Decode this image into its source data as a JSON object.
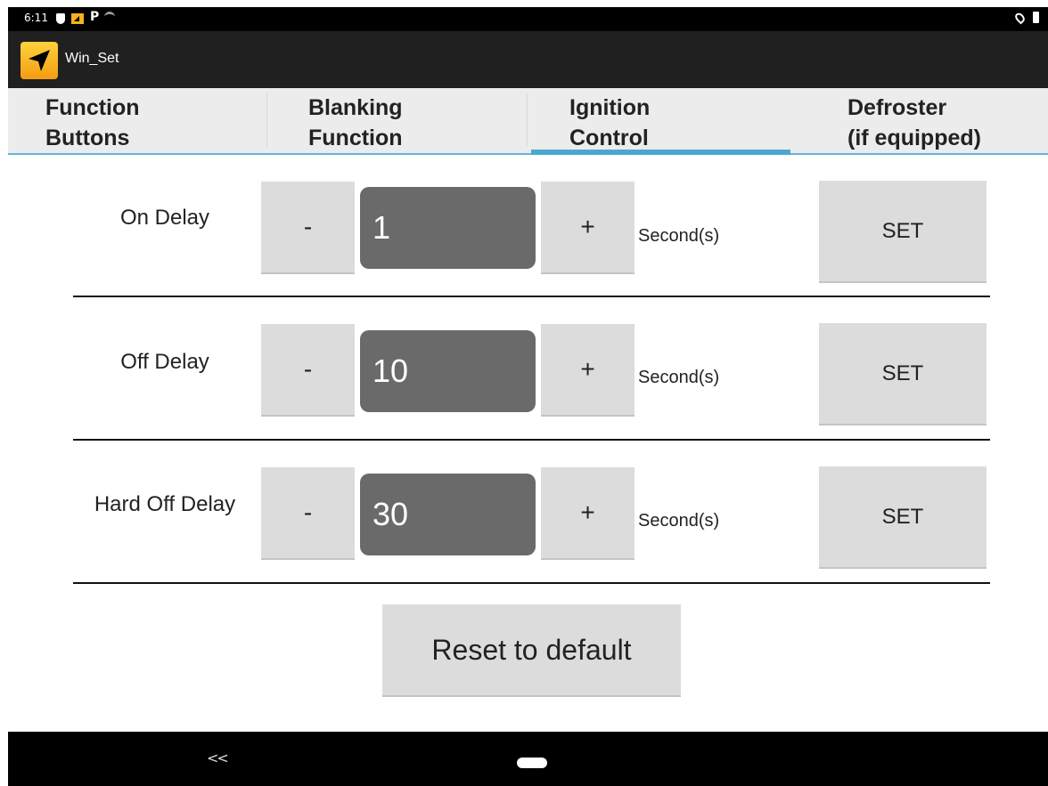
{
  "status_bar": {
    "time": "6:11",
    "p_glyph": "P"
  },
  "app_bar": {
    "title": "Win_Set",
    "logo_icon": "navigation-arrow-icon"
  },
  "tabs": [
    {
      "label": "Function\nButtons",
      "selected": false
    },
    {
      "label": "Blanking\nFunction",
      "selected": false
    },
    {
      "label": "Ignition\nControl",
      "selected": true
    },
    {
      "label": "Defroster\n(if equipped)",
      "selected": false
    }
  ],
  "rows": [
    {
      "label": "On Delay",
      "minus": "-",
      "value": "1",
      "plus": "+",
      "unit": "Second(s)",
      "set": "SET"
    },
    {
      "label": "Off Delay",
      "minus": "-",
      "value": "10",
      "plus": "+",
      "unit": "Second(s)",
      "set": "SET"
    },
    {
      "label": "Hard Off Delay",
      "minus": "-",
      "value": "30",
      "plus": "+",
      "unit": "Second(s)",
      "set": "SET"
    }
  ],
  "reset_label": "Reset to default",
  "nav": {
    "back_glyph": "<<"
  },
  "colors": {
    "accent": "#4aa8ce",
    "field_bg": "#6a6a6a",
    "button_bg": "#dcdcdc"
  }
}
